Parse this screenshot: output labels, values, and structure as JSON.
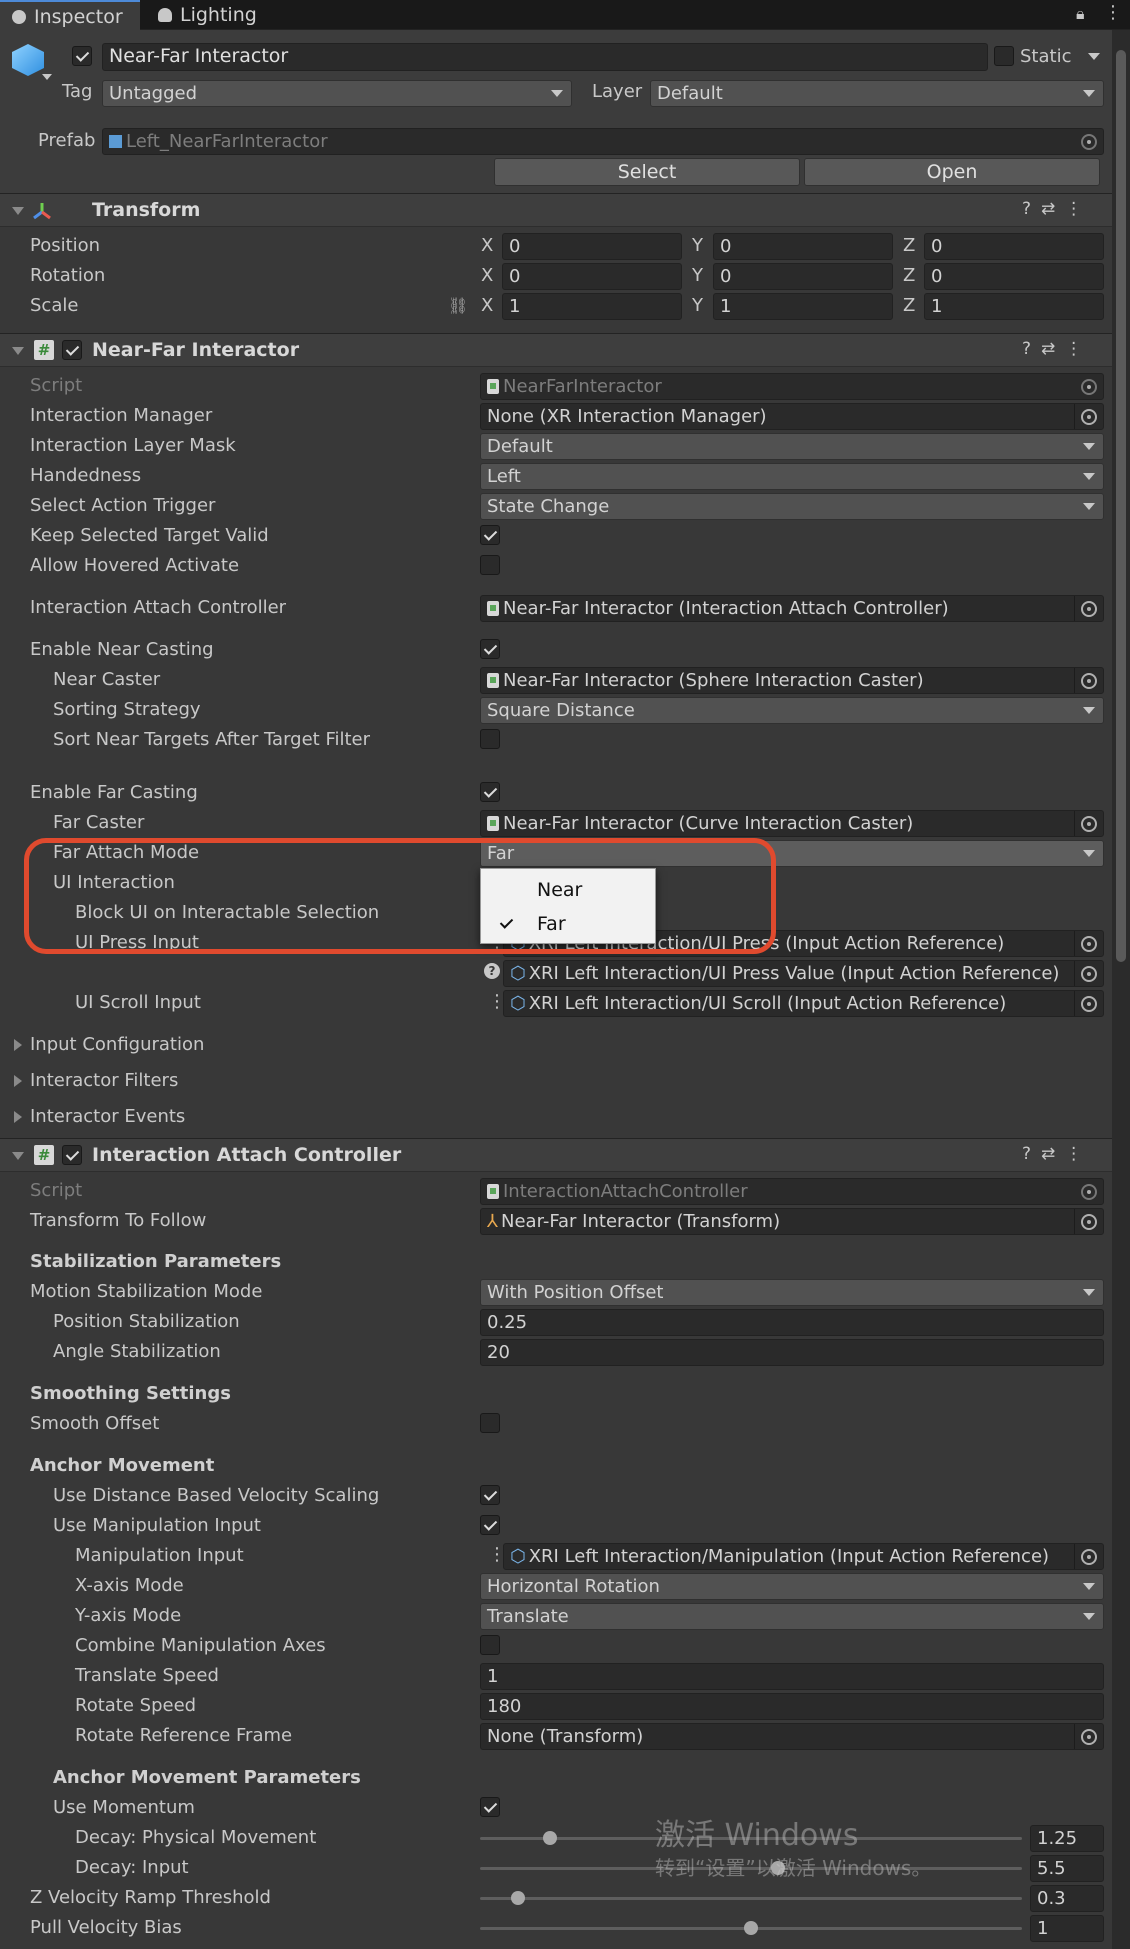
{
  "tabs": [
    {
      "label": "Inspector",
      "active": true
    },
    {
      "label": "Lighting",
      "active": false
    }
  ],
  "object": {
    "name": "Near-Far Interactor",
    "static_label": "Static",
    "tag_label": "Tag",
    "tag_value": "Untagged",
    "layer_label": "Layer",
    "layer_value": "Default",
    "prefab_label": "Prefab",
    "prefab_value": "Left_NearFarInteractor",
    "select_button": "Select",
    "open_button": "Open"
  },
  "transform": {
    "title": "Transform",
    "rows": [
      {
        "label": "Position",
        "x": "0",
        "y": "0",
        "z": "0"
      },
      {
        "label": "Rotation",
        "x": "0",
        "y": "0",
        "z": "0"
      },
      {
        "label": "Scale",
        "x": "1",
        "y": "1",
        "z": "1"
      }
    ],
    "axis_x": "X",
    "axis_y": "Y",
    "axis_z": "Z"
  },
  "nfi": {
    "title": "Near-Far Interactor",
    "script_label": "Script",
    "script_value": "NearFarInteractor",
    "interaction_manager_label": "Interaction Manager",
    "interaction_manager_value": "None (XR Interaction Manager)",
    "layer_mask_label": "Interaction Layer Mask",
    "layer_mask_value": "Default",
    "handedness_label": "Handedness",
    "handedness_value": "Left",
    "select_trigger_label": "Select Action Trigger",
    "select_trigger_value": "State Change",
    "keep_selected_label": "Keep Selected Target Valid",
    "keep_selected_checked": true,
    "allow_hovered_label": "Allow Hovered Activate",
    "allow_hovered_checked": false,
    "attach_controller_label": "Interaction Attach Controller",
    "attach_controller_value": "Near-Far Interactor (Interaction Attach Controller)",
    "enable_near_label": "Enable Near Casting",
    "enable_near_checked": true,
    "near_caster_label": "Near Caster",
    "near_caster_value": "Near-Far Interactor (Sphere Interaction Caster)",
    "sorting_label": "Sorting Strategy",
    "sorting_value": "Square Distance",
    "sort_near_label": "Sort Near Targets After Target Filter",
    "sort_near_checked": false,
    "enable_far_label": "Enable Far Casting",
    "enable_far_checked": true,
    "far_caster_label": "Far Caster",
    "far_caster_value": "Near-Far Interactor (Curve Interaction Caster)",
    "far_attach_label": "Far Attach Mode",
    "far_attach_value": "Far",
    "ui_interaction_label": "UI Interaction",
    "block_ui_label": "Block UI on Interactable Selection",
    "ui_press_label": "UI Press Input",
    "ui_press_value": "XRI Left Interaction/UI Press (Input Action Reference)",
    "ui_press_value2": "XRI Left Interaction/UI Press Value (Input Action Reference)",
    "ui_scroll_label": "UI Scroll Input",
    "ui_scroll_value": "XRI Left Interaction/UI Scroll (Input Action Reference)",
    "input_config": "Input Configuration",
    "interactor_filters": "Interactor Filters",
    "interactor_events": "Interactor Events"
  },
  "popup": {
    "options": [
      "Near",
      "Far"
    ],
    "selected": "Far"
  },
  "iac": {
    "title": "Interaction Attach Controller",
    "script_label": "Script",
    "script_value": "InteractionAttachController",
    "follow_label": "Transform To Follow",
    "follow_value": "Near-Far Interactor (Transform)",
    "stab_header": "Stabilization Parameters",
    "motion_mode_label": "Motion Stabilization Mode",
    "motion_mode_value": "With Position Offset",
    "pos_stab_label": "Position Stabilization",
    "pos_stab_value": "0.25",
    "angle_stab_label": "Angle Stabilization",
    "angle_stab_value": "20",
    "smooth_header": "Smoothing Settings",
    "smooth_offset_label": "Smooth Offset",
    "smooth_offset_checked": false,
    "anchor_header": "Anchor Movement",
    "dist_vel_label": "Use Distance Based Velocity Scaling",
    "dist_vel_checked": true,
    "manip_input_use_label": "Use Manipulation Input",
    "manip_input_use_checked": true,
    "manip_input_label": "Manipulation Input",
    "manip_input_value": "XRI Left Interaction/Manipulation (Input Action Reference)",
    "xaxis_label": "X-axis Mode",
    "xaxis_value": "Horizontal Rotation",
    "yaxis_label": "Y-axis Mode",
    "yaxis_value": "Translate",
    "combine_label": "Combine Manipulation Axes",
    "combine_checked": false,
    "translate_label": "Translate Speed",
    "translate_value": "1",
    "rotate_label": "Rotate Speed",
    "rotate_value": "180",
    "rotate_frame_label": "Rotate Reference Frame",
    "rotate_frame_value": "None (Transform)",
    "anchor_params_header": "Anchor Movement Parameters",
    "momentum_label": "Use Momentum",
    "momentum_checked": true,
    "sliders": [
      {
        "label": "Decay: Physical Movement",
        "value": "1.25",
        "fraction": 0.13
      },
      {
        "label": "Decay: Input",
        "value": "5.5",
        "fraction": 0.55
      },
      {
        "label": "Z Velocity Ramp Threshold",
        "value": "0.3",
        "fraction": 0.07
      },
      {
        "label": "Pull Velocity Bias",
        "value": "1",
        "fraction": 0.5
      }
    ]
  },
  "watermark": {
    "line1": "激活 Windows",
    "line2": "转到“设置”以激活 Windows。"
  },
  "colors": {
    "accent": "#4d8ad8",
    "highlight": "#e04a2e"
  }
}
